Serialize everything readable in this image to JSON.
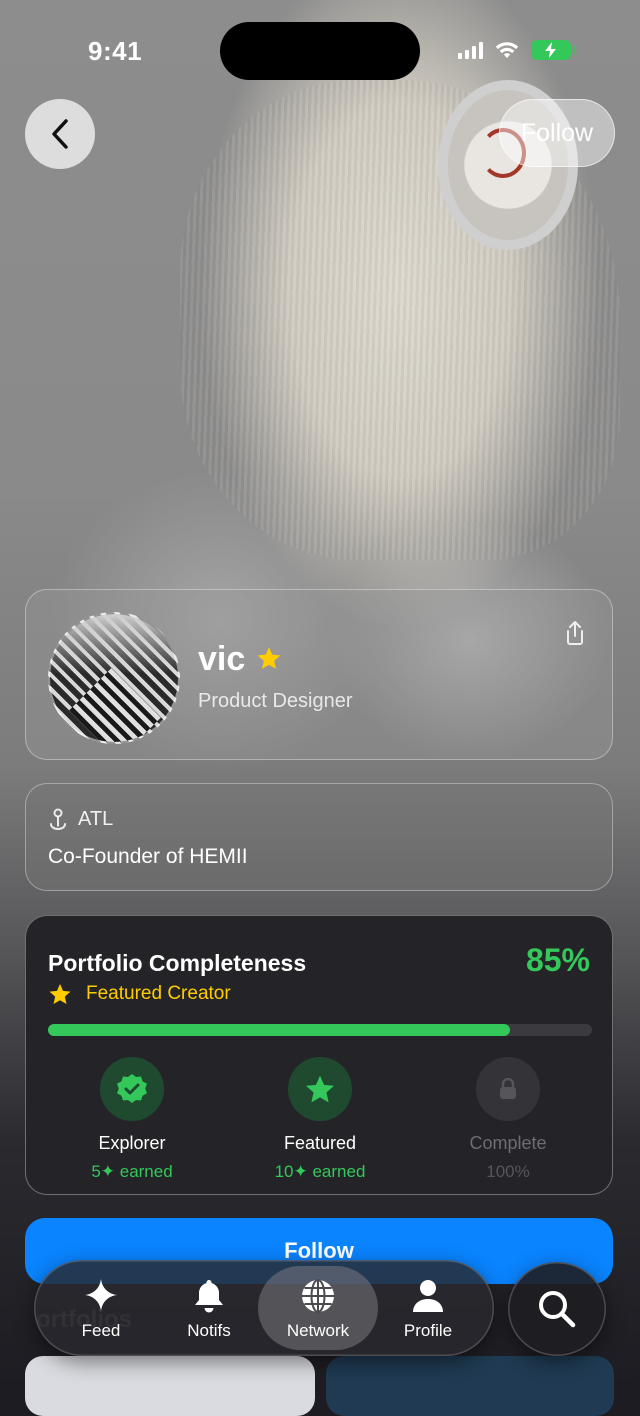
{
  "status_bar": {
    "time": "9:41"
  },
  "header": {
    "follow_label": "Follow"
  },
  "profile": {
    "name": "vic",
    "role": "Product Designer",
    "location": "ATL",
    "bio": "Co-Founder of HEMII"
  },
  "portfolio": {
    "title": "Portfolio Completeness",
    "percent_label": "85%",
    "progress_fraction": 0.85,
    "featured_label": "Featured Creator",
    "badges": [
      {
        "label": "Explorer",
        "sub": "5✦ earned",
        "state": "earned",
        "icon": "check-seal-icon"
      },
      {
        "label": "Featured",
        "sub": "10✦ earned",
        "state": "earned",
        "icon": "star-icon"
      },
      {
        "label": "Complete",
        "sub": "100%",
        "state": "locked",
        "icon": "lock-icon"
      }
    ]
  },
  "follow_button_label": "Follow",
  "below_fold_text": "ortfolios",
  "tabbar": {
    "items": [
      {
        "label": "Feed",
        "icon": "sparkle-icon"
      },
      {
        "label": "Notifs",
        "icon": "bell-icon"
      },
      {
        "label": "Network",
        "icon": "globe-icon",
        "active": true
      },
      {
        "label": "Profile",
        "icon": "person-icon"
      }
    ]
  },
  "colors": {
    "accent_green": "#34c759",
    "featured_yellow": "#ffcc00",
    "primary_blue": "#0a84ff"
  }
}
